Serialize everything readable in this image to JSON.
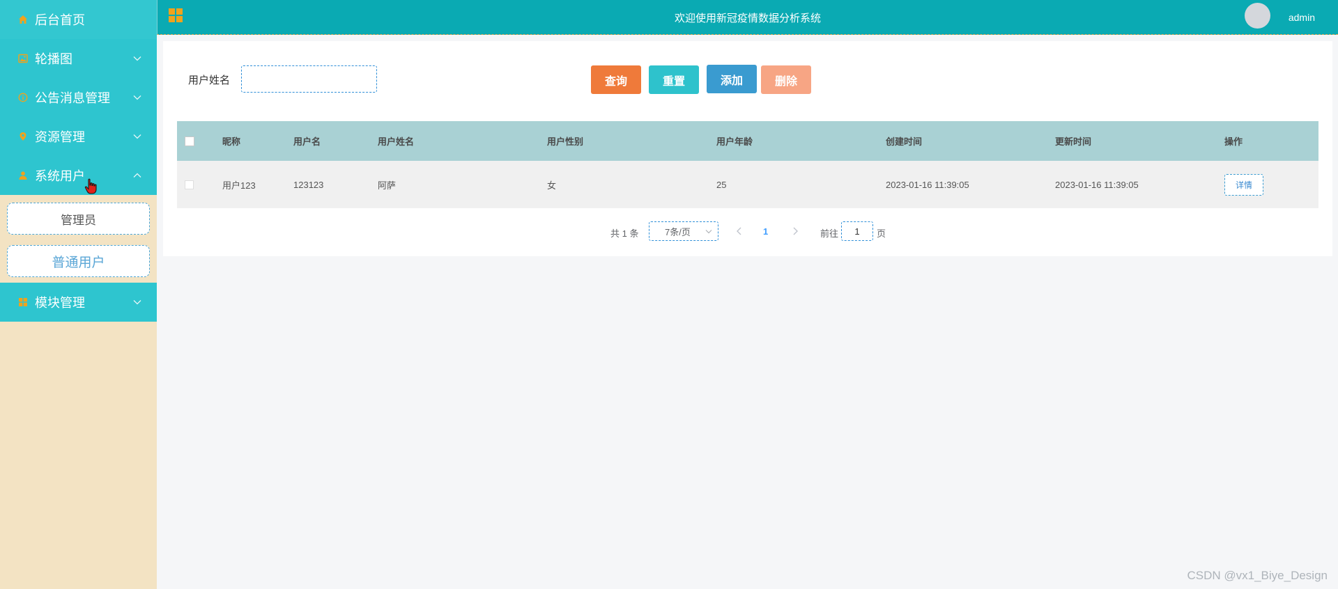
{
  "sidebar": {
    "items": [
      {
        "label": "后台首页",
        "icon": "home-icon"
      },
      {
        "label": "轮播图",
        "icon": "image-icon"
      },
      {
        "label": "公告消息管理",
        "icon": "info-icon"
      },
      {
        "label": "资源管理",
        "icon": "location-icon"
      },
      {
        "label": "系统用户",
        "icon": "user-icon"
      },
      {
        "label": "模块管理",
        "icon": "grid-icon"
      }
    ],
    "submenu": [
      {
        "label": "管理员"
      },
      {
        "label": "普通用户"
      }
    ]
  },
  "header": {
    "title": "欢迎使用新冠疫情数据分析系统",
    "username": "admin"
  },
  "search": {
    "label": "用户姓名",
    "value": "",
    "placeholder": ""
  },
  "buttons": {
    "query": "查询",
    "reset": "重置",
    "add": "添加",
    "delete": "删除"
  },
  "table": {
    "headers": [
      "昵称",
      "用户名",
      "用户姓名",
      "用户性别",
      "用户年龄",
      "创建时间",
      "更新时间",
      "操作"
    ],
    "rows": [
      {
        "nickname": "用户123",
        "username": "123123",
        "name": "阿萨",
        "gender": "女",
        "age": "25",
        "created": "2023-01-16 11:39:05",
        "updated": "2023-01-16 11:39:05",
        "action": "详情"
      }
    ]
  },
  "pagination": {
    "total": "共 1 条",
    "page_size": "7条/页",
    "current": "1",
    "goto_label": "前往",
    "goto_value": "1",
    "page_suffix": "页"
  },
  "watermark": "CSDN @vx1_Biye_Design",
  "colors": {
    "sidebar_item": "#2ec5cf",
    "sidebar_bg": "#f3e3c3",
    "header": "#0aaab3",
    "table_header": "#a9d1d4",
    "btn_query": "#ef7a3a",
    "btn_reset": "#2ec2cc",
    "btn_add": "#3a9bd0",
    "btn_delete": "#f7a584",
    "icon_orange": "#f0a31c"
  }
}
